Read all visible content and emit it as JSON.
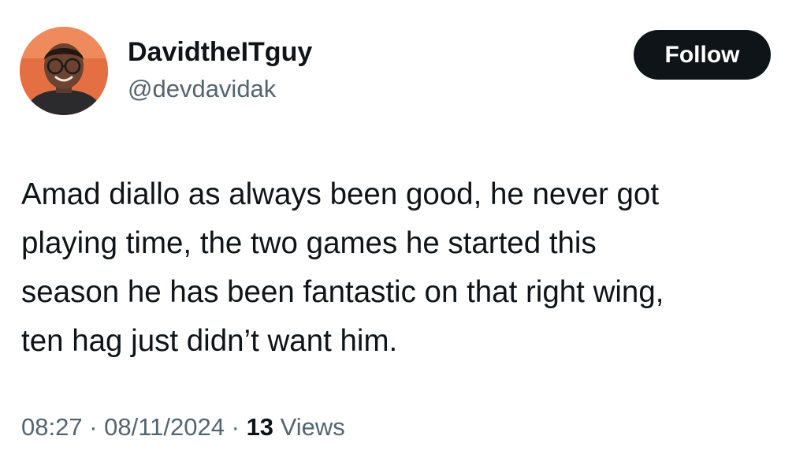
{
  "author": {
    "display_name": "DavidtheITguy",
    "handle": "@devdavidak",
    "avatar_icon": "profile-photo"
  },
  "follow_button": {
    "label": "Follow"
  },
  "tweet": {
    "text_lines": [
      "Amad diallo as always been good, he never got",
      "playing time, the two games he started this",
      "season he has been fantastic on that right wing,",
      "ten hag just didn’t want him."
    ]
  },
  "meta": {
    "time": "08:27",
    "separator": " · ",
    "date": "08/11/2024",
    "views_count": "13",
    "views_label": " Views"
  },
  "colors": {
    "text_primary": "#0f1419",
    "text_secondary": "#536471",
    "button_bg": "#0f1419",
    "avatar_bg": "#e46f43"
  }
}
